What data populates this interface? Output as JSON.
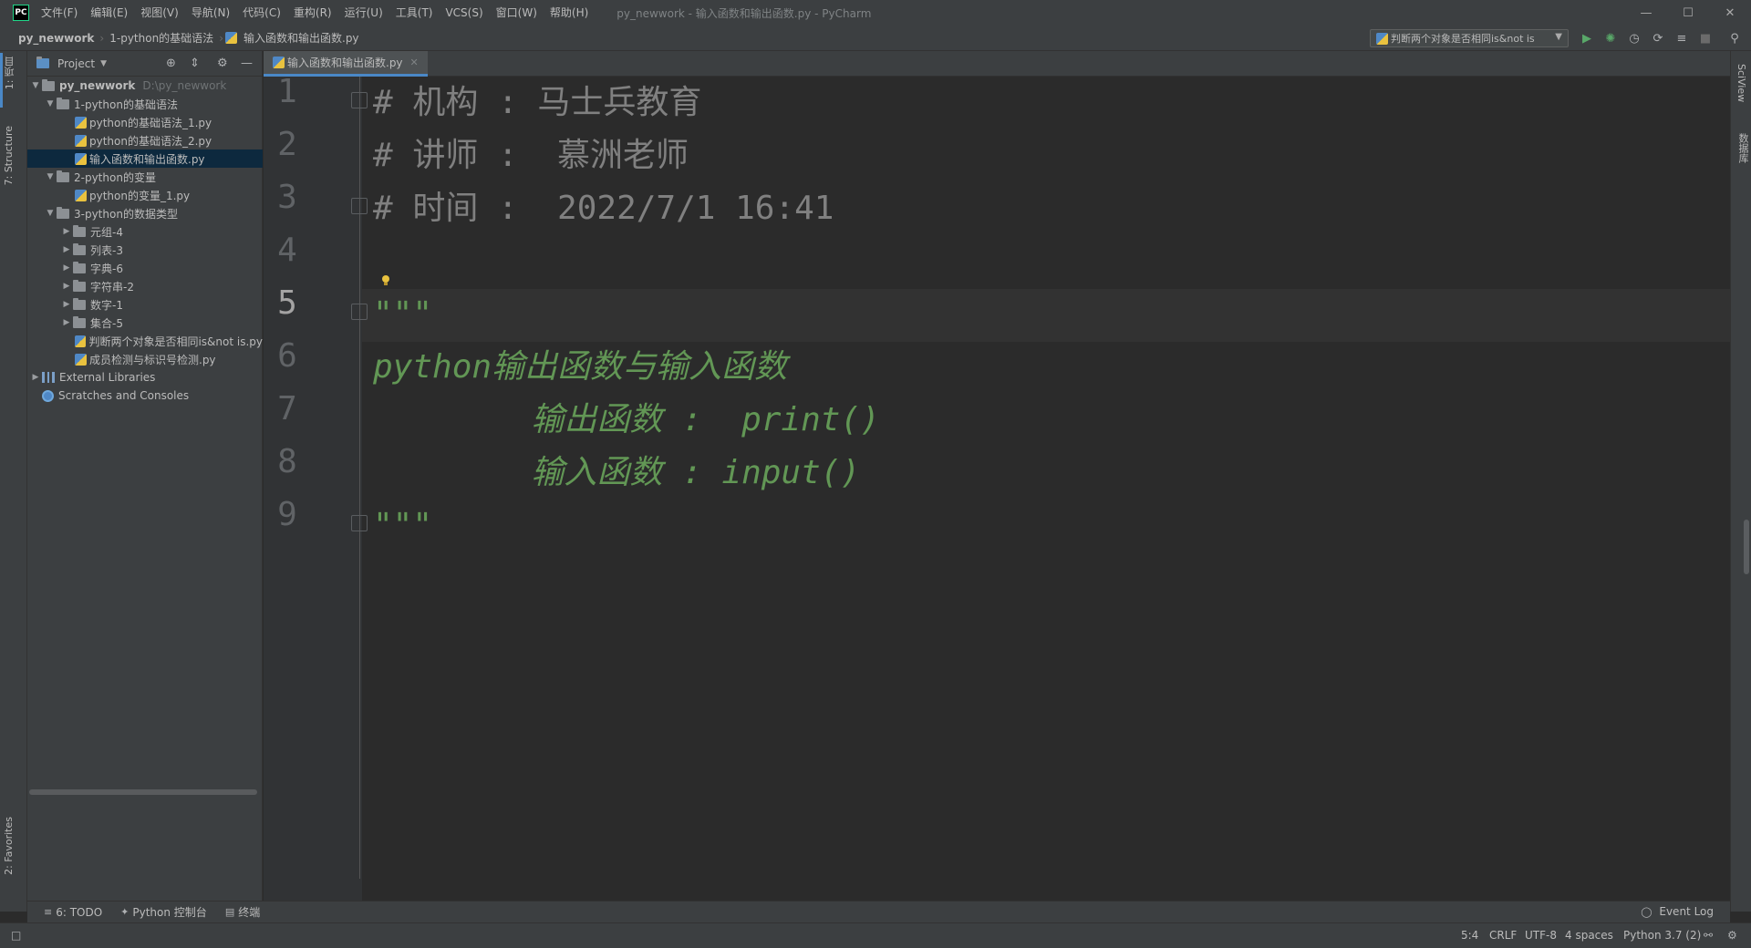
{
  "titlebar": {
    "app_logo": "PC",
    "menu": [
      "文件(F)",
      "编辑(E)",
      "视图(V)",
      "导航(N)",
      "代码(C)",
      "重构(R)",
      "运行(U)",
      "工具(T)",
      "VCS(S)",
      "窗口(W)",
      "帮助(H)"
    ],
    "window_title": "py_newwork - 输入函数和输出函数.py - PyCharm"
  },
  "navbar": {
    "breadcrumbs": [
      "py_newwork",
      "1-python的基础语法",
      "输入函数和输出函数.py"
    ],
    "run_config": "判断两个对象是否相同is&not is"
  },
  "left_stripe": {
    "project_label": "1: 项目",
    "structure_label": "7: Structure",
    "favorites_label": "2: Favorites"
  },
  "project_panel": {
    "title": "Project",
    "tree": [
      {
        "label": "py_newwork",
        "hint": "D:\\py_newwork",
        "type": "folder",
        "expanded": true,
        "bold": true
      },
      {
        "label": "1-python的基础语法",
        "type": "folder",
        "expanded": true
      },
      {
        "label": "python的基础语法_1.py",
        "type": "file"
      },
      {
        "label": "python的基础语法_2.py",
        "type": "file"
      },
      {
        "label": "输入函数和输出函数.py",
        "type": "file",
        "selected": true
      },
      {
        "label": "2-python的变量",
        "type": "folder",
        "expanded": true
      },
      {
        "label": "python的变量_1.py",
        "type": "file"
      },
      {
        "label": "3-python的数据类型",
        "type": "folder",
        "expanded": true
      },
      {
        "label": "元组-4",
        "type": "folder",
        "expanded": false
      },
      {
        "label": "列表-3",
        "type": "folder",
        "expanded": false
      },
      {
        "label": "字典-6",
        "type": "folder",
        "expanded": false
      },
      {
        "label": "字符串-2",
        "type": "folder",
        "expanded": false
      },
      {
        "label": "数字-1",
        "type": "folder",
        "expanded": false
      },
      {
        "label": "集合-5",
        "type": "folder",
        "expanded": false
      },
      {
        "label": "判断两个对象是否相同is&not is.py",
        "type": "file"
      },
      {
        "label": "成员检测与标识号检测.py",
        "type": "file"
      },
      {
        "label": "External Libraries",
        "type": "library",
        "expanded": false
      },
      {
        "label": "Scratches and Consoles",
        "type": "scratch"
      }
    ]
  },
  "editor": {
    "tab_label": "输入函数和输出函数.py",
    "line_numbers": [
      "1",
      "2",
      "3",
      "4",
      "5",
      "6",
      "7",
      "8",
      "9"
    ],
    "lines": [
      {
        "text": "# 机构 : 马士兵教育",
        "style": "cmt"
      },
      {
        "text": "# 讲师 :  慕洲老师",
        "style": "cmt"
      },
      {
        "text": "# 时间 :  2022/7/1 16:41",
        "style": "cmt"
      },
      {
        "text": "",
        "style": "cmt"
      },
      {
        "text": "\"\"\"",
        "style": "doc"
      },
      {
        "text": "python输出函数与输入函数",
        "style": "doc"
      },
      {
        "text": "        输出函数 :  print()",
        "style": "doc"
      },
      {
        "text": "        输入函数 : input()",
        "style": "doc"
      },
      {
        "text": "\"\"\"",
        "style": "doc"
      }
    ],
    "current_line": 5
  },
  "right_stripe": {
    "sciview_label": "SciView",
    "database_label": "数据库"
  },
  "bottom_bar": {
    "todo": "6: TODO",
    "python_console": "Python 控制台",
    "terminal": "终端",
    "event_log": "Event Log"
  },
  "status_bar": {
    "position": "5:4",
    "line_ending": "CRLF",
    "encoding": "UTF-8",
    "indent": "4 spaces",
    "interpreter": "Python 3.7 (2)"
  },
  "colors": {
    "accent": "#4a88c7",
    "comment": "#808080",
    "docstring": "#629755",
    "selection": "#0d293e"
  }
}
